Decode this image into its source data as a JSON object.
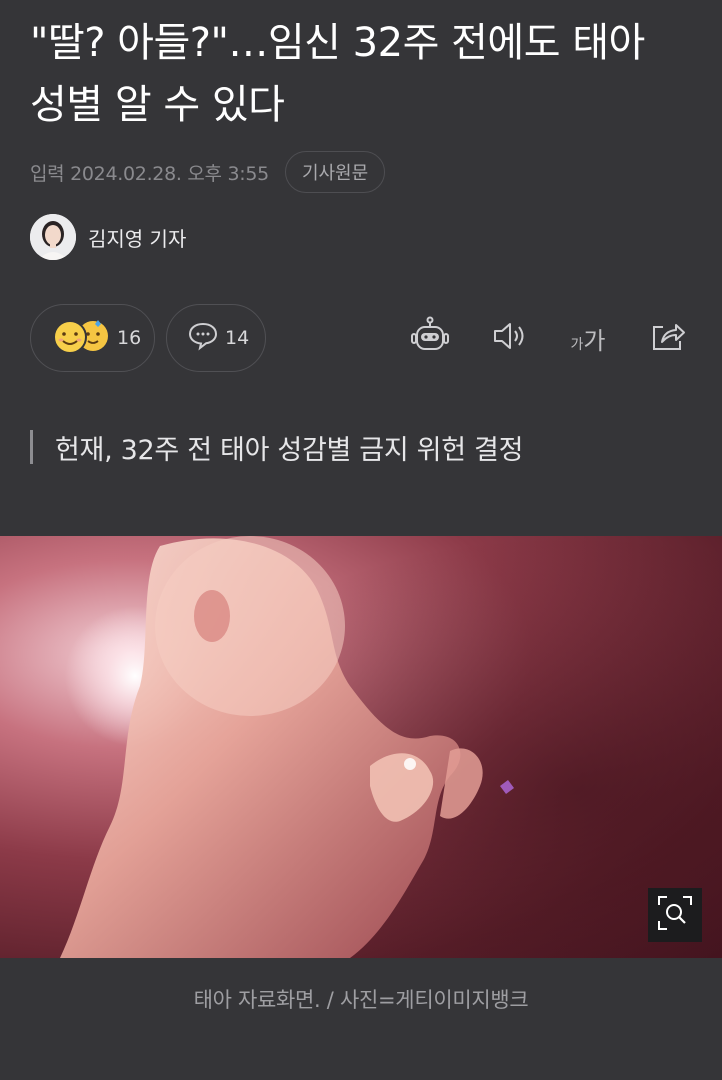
{
  "article": {
    "headline": "\"딸? 아들?\"…임신 32주 전에도 태아 성별 알 수 있다",
    "published": "입력 2024.02.28. 오후 3:55",
    "source_button": "기사원문",
    "reporter": "김지영 기자",
    "subheadline": "헌재, 32주 전 태아 성감별 금지 위헌 결정",
    "photo_caption": "태아 자료화면. / 사진=게티이미지뱅크"
  },
  "actions": {
    "reaction_count": "16",
    "comment_count": "14",
    "font_size_label_small": "가",
    "font_size_label_large": "가"
  },
  "icons": {
    "reaction": "emoji-reaction-icon",
    "comment": "speech-bubble-icon",
    "summary_bot": "robot-icon",
    "tts": "speaker-icon",
    "font_size": "font-size-icon",
    "share": "share-icon",
    "zoom": "zoom-icon"
  },
  "colors": {
    "background": "#353538",
    "text_primary": "#ffffff",
    "text_muted": "#8a8a8e",
    "border": "#505054"
  }
}
